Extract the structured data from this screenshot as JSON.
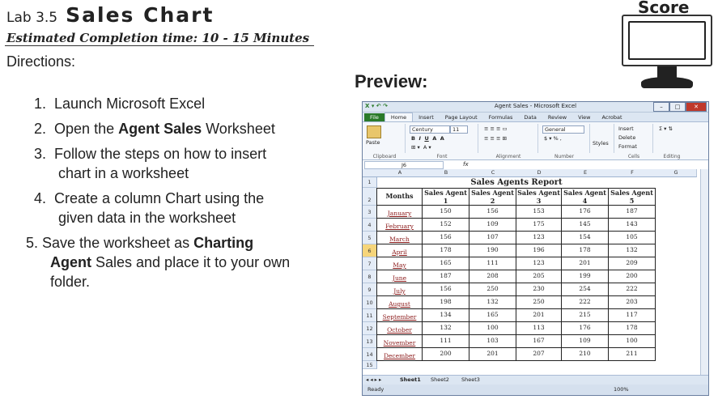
{
  "lab": {
    "number": "Lab 3.5",
    "title": "Sales Chart",
    "estimate": "Estimated Completion time: 10 - 15 Minutes",
    "directions": "Directions:",
    "steps": [
      {
        "num": "1.",
        "text": "Launch Microsoft Excel"
      },
      {
        "num": "2.",
        "pre": "Open the ",
        "bold": "Agent Sales",
        "post": " Worksheet"
      },
      {
        "num": "3.",
        "line1": "Follow the steps on how to insert",
        "line2": "chart in a worksheet"
      },
      {
        "num": "4.",
        "line1": "Create a column Chart using the",
        "line2": "given data in the worksheet"
      },
      {
        "num": "5.",
        "pre": "Save the worksheet as ",
        "bold": "Charting",
        "bold2": "Agent",
        "line2rest": " Sales and place it to your own",
        "line3": "folder."
      }
    ],
    "preview": "Preview:",
    "score": "Score"
  },
  "excel": {
    "window_title": "Agent Sales - Microsoft Excel",
    "tabs": [
      "File",
      "Home",
      "Insert",
      "Page Layout",
      "Formulas",
      "Data",
      "Review",
      "View",
      "Acrobat"
    ],
    "font_name": "Century",
    "font_size": "11",
    "number_format": "General",
    "groups": [
      "Clipboard",
      "Font",
      "Alignment",
      "Number",
      "Cells",
      "Editing"
    ],
    "ribbon": {
      "paste": "Paste",
      "styles": "Styles",
      "insert": "Insert",
      "delete": "Delete",
      "format": "Format"
    },
    "name_box": "J6",
    "fx": "fx",
    "columns": [
      "A",
      "B",
      "C",
      "D",
      "E",
      "F",
      "G"
    ],
    "report_title": "Sales Agents Report",
    "header": [
      "Months",
      "Sales Agent 1",
      "Sales Agent 2",
      "Sales Agent 3",
      "Sales Agent 4",
      "Sales Agent 5"
    ],
    "rows": [
      {
        "month": "January",
        "v": [
          150,
          156,
          153,
          176,
          187
        ]
      },
      {
        "month": "February",
        "v": [
          152,
          109,
          175,
          145,
          143
        ]
      },
      {
        "month": "March",
        "v": [
          156,
          107,
          123,
          154,
          105
        ]
      },
      {
        "month": "April",
        "v": [
          178,
          190,
          196,
          178,
          132
        ]
      },
      {
        "month": "May",
        "v": [
          165,
          111,
          123,
          201,
          209
        ]
      },
      {
        "month": "June",
        "v": [
          187,
          208,
          205,
          199,
          200
        ]
      },
      {
        "month": "July",
        "v": [
          156,
          250,
          230,
          254,
          222
        ]
      },
      {
        "month": "August",
        "v": [
          198,
          132,
          250,
          222,
          203
        ]
      },
      {
        "month": "September",
        "v": [
          134,
          165,
          201,
          215,
          117
        ]
      },
      {
        "month": "October",
        "v": [
          132,
          100,
          113,
          176,
          178
        ]
      },
      {
        "month": "November",
        "v": [
          111,
          103,
          167,
          109,
          100
        ]
      },
      {
        "month": "December",
        "v": [
          200,
          201,
          207,
          210,
          211
        ]
      }
    ],
    "sheets": [
      "Sheet1",
      "Sheet2",
      "Sheet3"
    ],
    "status": "Ready",
    "zoom": "100%"
  }
}
